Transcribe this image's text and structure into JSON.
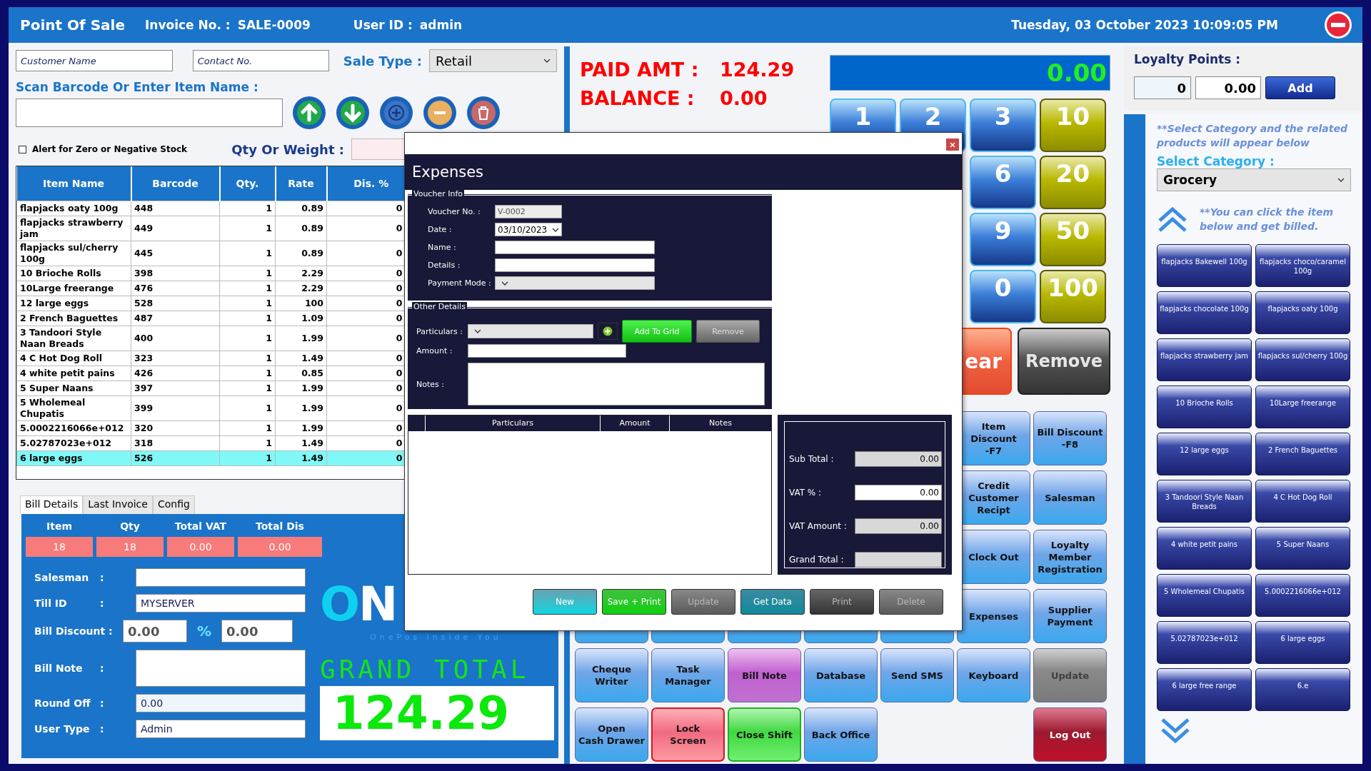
{
  "header": {
    "title": "Point Of Sale",
    "invoice_label": "Invoice No. :",
    "invoice_no": "SALE-0009",
    "user_label": "User ID :",
    "user_id": "admin",
    "datetime": "Tuesday, 03 October 2023 10:09:05 PM"
  },
  "customer": {
    "name_placeholder": "Customer Name",
    "contact_placeholder": "Contact No.",
    "sale_type_label": "Sale Type :",
    "sale_type": "Retail"
  },
  "scan": {
    "label": "Scan Barcode Or Enter Item Name :",
    "actions": [
      {
        "kind": "up"
      },
      {
        "kind": "down"
      },
      {
        "kind": "add"
      },
      {
        "kind": "minus"
      },
      {
        "kind": "delete"
      }
    ]
  },
  "alert": {
    "label": "Alert for Zero or Negative Stock",
    "checked": false
  },
  "qty_label": "Qty Or Weight :",
  "items_table": {
    "columns": [
      "Item Name",
      "Barcode",
      "Qty.",
      "Rate",
      "Dis. %"
    ],
    "rows": [
      {
        "cells": [
          "flapjacks oaty 100g",
          "448",
          "1",
          "0.89",
          "0"
        ],
        "selected": false
      },
      {
        "cells": [
          "flapjacks strawberry jam",
          "449",
          "1",
          "0.89",
          "0"
        ],
        "selected": false
      },
      {
        "cells": [
          "flapjacks sul/cherry 100g",
          "445",
          "1",
          "0.89",
          "0"
        ],
        "selected": false
      },
      {
        "cells": [
          "10 Brioche Rolls",
          "398",
          "1",
          "2.29",
          "0"
        ],
        "selected": false
      },
      {
        "cells": [
          "10Large freerange",
          "476",
          "1",
          "2.29",
          "0"
        ],
        "selected": false
      },
      {
        "cells": [
          "12 large eggs",
          "528",
          "1",
          "100",
          "0"
        ],
        "selected": false
      },
      {
        "cells": [
          "2 French Baguettes",
          "487",
          "1",
          "1.09",
          "0"
        ],
        "selected": false
      },
      {
        "cells": [
          "3 Tandoori Style Naan Breads",
          "400",
          "1",
          "1.99",
          "0"
        ],
        "selected": false
      },
      {
        "cells": [
          "4 C Hot Dog Roll",
          "323",
          "1",
          "1.49",
          "0"
        ],
        "selected": false
      },
      {
        "cells": [
          "4 white petit pains",
          "426",
          "1",
          "0.85",
          "0"
        ],
        "selected": false
      },
      {
        "cells": [
          "5 Super Naans",
          "397",
          "1",
          "1.99",
          "0"
        ],
        "selected": false
      },
      {
        "cells": [
          "5 Wholemeal Chupatis",
          "399",
          "1",
          "1.99",
          "0"
        ],
        "selected": false
      },
      {
        "cells": [
          "5.0002216066e+012",
          "320",
          "1",
          "1.99",
          "0"
        ],
        "selected": false
      },
      {
        "cells": [
          "5.02787023e+012",
          "318",
          "1",
          "1.49",
          "0"
        ],
        "selected": false
      },
      {
        "cells": [
          "6 large eggs",
          "526",
          "1",
          "1.49",
          "0"
        ],
        "selected": true
      }
    ]
  },
  "bill_tabs": [
    {
      "label": "Bill Details",
      "selected": true
    },
    {
      "label": "Last Invoice",
      "selected": false
    },
    {
      "label": "Config",
      "selected": false
    }
  ],
  "bill_summary": [
    {
      "label": "Item",
      "value": "18"
    },
    {
      "label": "Qty",
      "value": "18"
    },
    {
      "label": "Total VAT",
      "value": "0.00"
    },
    {
      "label": "Total Dis",
      "value": "0.00"
    }
  ],
  "bill_fields": [
    {
      "kind": "text",
      "label": "Salesman",
      "separator": ":"
    },
    {
      "kind": "text",
      "label": "Till ID",
      "separator": ":",
      "value": "MYSERVER"
    },
    {
      "kind": "discount",
      "label": "Bill Discount :",
      "value": "0.00",
      "percent_sign": "%",
      "amount": "0.00"
    },
    {
      "kind": "note",
      "label": "Bill Note",
      "separator": ":"
    },
    {
      "kind": "readonly",
      "label": "Round Off",
      "separator": ":",
      "value": "0.00"
    },
    {
      "kind": "text",
      "label": "User Type",
      "separator": ":",
      "value": "Admin"
    }
  ],
  "logo": {
    "text": "ON",
    "tagline": "OnePos Inside You"
  },
  "grand_total": {
    "label": "GRAND TOTAL",
    "value": "124.29"
  },
  "payment": {
    "paid_label": "PAID AMT :",
    "paid": "124.29",
    "balance_label": "BALANCE :",
    "balance": "0.00",
    "display": "0.00"
  },
  "keypad": [
    {
      "kind": "digit",
      "label": "1"
    },
    {
      "kind": "digit",
      "label": "2"
    },
    {
      "kind": "digit",
      "label": "3"
    },
    {
      "kind": "note",
      "label": "10"
    },
    {
      "kind": "covered"
    },
    {
      "kind": "covered"
    },
    {
      "kind": "digit",
      "label": "6"
    },
    {
      "kind": "note",
      "label": "20"
    },
    {
      "kind": "covered"
    },
    {
      "kind": "covered"
    },
    {
      "kind": "digit",
      "label": "9"
    },
    {
      "kind": "note",
      "label": "50"
    },
    {
      "kind": "covered"
    },
    {
      "kind": "covered"
    },
    {
      "kind": "digit",
      "label": "0"
    },
    {
      "kind": "note",
      "label": "100"
    }
  ],
  "keypad_actions": [
    {
      "kind": "clear",
      "label": "ear"
    },
    {
      "kind": "remove",
      "label": "Remove"
    }
  ],
  "functions": [
    {
      "kind": "covered"
    },
    {
      "kind": "covered"
    },
    {
      "kind": "covered"
    },
    {
      "kind": "covered"
    },
    {
      "kind": "covered"
    },
    {
      "kind": "blue",
      "label": "Item Discount\n-F7"
    },
    {
      "kind": "blue",
      "label": "Bill Discount\n-F8"
    },
    {
      "kind": "covered"
    },
    {
      "kind": "covered"
    },
    {
      "kind": "covered"
    },
    {
      "kind": "covered"
    },
    {
      "kind": "covered"
    },
    {
      "kind": "blue",
      "label": "Credit\nCustomer\nRecipt"
    },
    {
      "kind": "blue",
      "label": "Salesman"
    },
    {
      "kind": "covered"
    },
    {
      "kind": "covered"
    },
    {
      "kind": "covered"
    },
    {
      "kind": "covered"
    },
    {
      "kind": "covered"
    },
    {
      "kind": "blue",
      "label": "Clock Out"
    },
    {
      "kind": "blue",
      "label": "Loyalty\nMember\nRegistration"
    },
    {
      "kind": "blank"
    },
    {
      "kind": "blank"
    },
    {
      "kind": "blank"
    },
    {
      "kind": "blank"
    },
    {
      "kind": "blank"
    },
    {
      "kind": "blue",
      "label": "Expenses"
    },
    {
      "kind": "blue",
      "label": "Supplier\nPayment"
    },
    {
      "kind": "blue",
      "label": "Cheque Writer"
    },
    {
      "kind": "blue",
      "label": "Task Manager"
    },
    {
      "kind": "purple",
      "label": "Bill Note"
    },
    {
      "kind": "blue",
      "label": "Database"
    },
    {
      "kind": "blue",
      "label": "Send SMS"
    },
    {
      "kind": "blue",
      "label": "Keyboard"
    },
    {
      "kind": "grey",
      "label": "Update"
    },
    {
      "kind": "blue",
      "label": "Open\nCash Drawer"
    },
    {
      "kind": "red",
      "label": "Lock\nScreen"
    },
    {
      "kind": "green",
      "label": "Close Shift"
    },
    {
      "kind": "blue",
      "label": "Back Office"
    },
    {
      "kind": "empty"
    },
    {
      "kind": "empty"
    },
    {
      "kind": "maroon",
      "label": "Log Out"
    }
  ],
  "loyalty": {
    "label": "Loyalty Points :",
    "points": "0",
    "amount": "0.00",
    "button": "Add"
  },
  "category": {
    "hint": "**Select Category and  the related products  will appear below",
    "label": "Select Category :",
    "value": "Grocery",
    "hint2": "**You can click the item below and get billed."
  },
  "products": [
    "flapjacks Bakewell 100g",
    "flapjacks choco/caramel 100g",
    "flapjacks chocolate 100g",
    "flapjacks oaty 100g",
    "flapjacks strawberry jam",
    "flapjacks sul/cherry 100g",
    "10 Brioche Rolls",
    "10Large freerange",
    "12 large eggs",
    "2 French Baguettes",
    "3 Tandoori Style Naan Breads",
    "4 C Hot Dog Roll",
    "4 white petit pains",
    "5 Super Naans",
    "5 Wholemeal Chupatis",
    "5.0002216066e+012",
    "5.02787023e+012",
    "6 large eggs",
    "6 large free range",
    "6.e"
  ],
  "expenses_dialog": {
    "title": "Expenses",
    "voucher": {
      "legend": "Voucher Info",
      "fields": [
        {
          "kind": "readonly",
          "label": "Voucher No. :",
          "value": "V-0002"
        },
        {
          "kind": "date",
          "label": "Date :",
          "value": "03/10/2023"
        },
        {
          "kind": "text",
          "label": "Name :"
        },
        {
          "kind": "text",
          "label": "Details :"
        },
        {
          "kind": "select",
          "label": "Payment Mode :"
        }
      ]
    },
    "other": {
      "legend": "Other Details",
      "particulars_label": "Particulars :",
      "amount_label": "Amount :",
      "notes_label": "Notes :",
      "add_button": "Add To Grid",
      "remove_button": "Remove"
    },
    "grid_columns": [
      "Particulars",
      "Amount",
      "Notes"
    ],
    "totals": [
      {
        "label": "Sub Total :",
        "value": "0.00",
        "readonly": true
      },
      {
        "label": "VAT % :",
        "value": "0.00",
        "readonly": false
      },
      {
        "label": "VAT Amount :",
        "value": "0.00",
        "readonly": true
      },
      {
        "label": "Grand Total :",
        "readonly": true
      }
    ],
    "buttons": [
      {
        "kind": "cyan",
        "label": "New",
        "disabled": false
      },
      {
        "kind": "green",
        "label": "Save + Print",
        "disabled": false
      },
      {
        "kind": "grey",
        "label": "Update",
        "disabled": true
      },
      {
        "kind": "teal",
        "label": "Get Data",
        "disabled": false
      },
      {
        "kind": "dark",
        "label": "Print",
        "disabled": true
      },
      {
        "kind": "grey",
        "label": "Delete",
        "disabled": true
      }
    ]
  }
}
